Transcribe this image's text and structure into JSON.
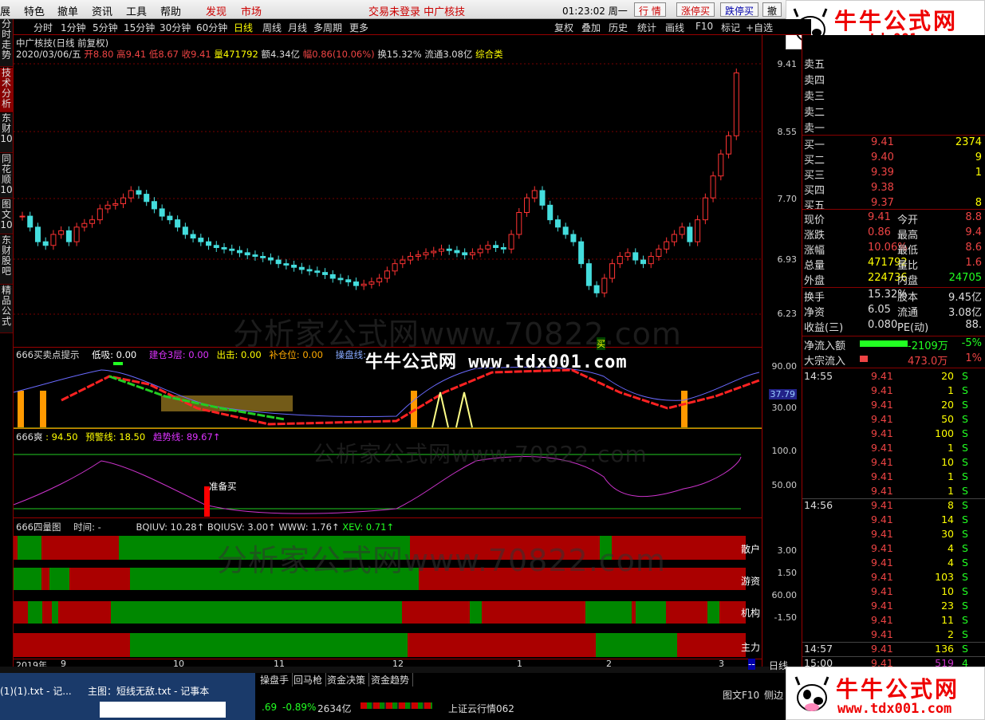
{
  "menu": {
    "items": [
      "展",
      "特色",
      "撤单",
      "资讯",
      "工具",
      "帮助"
    ],
    "red_items": [
      "发现",
      "市场"
    ],
    "status": "交易未登录 中广核技",
    "time": "01:23:02 周一",
    "right_buttons": [
      "行 情",
      "涨停买",
      "跌停买",
      "撤"
    ]
  },
  "sidebar": {
    "items": [
      "分时走势",
      "技术分析",
      "东财10",
      "同花顺10",
      "图文10",
      "东财股吧",
      "精品公式"
    ]
  },
  "periods": {
    "items": [
      "分时",
      "1分钟",
      "5分钟",
      "15分钟",
      "30分钟",
      "60分钟",
      "日线",
      "周线",
      "月线",
      "多周期",
      "更多"
    ],
    "right": [
      "复权",
      "叠加",
      "历史",
      "统计",
      "画线",
      "F10",
      "标记",
      "+自选"
    ]
  },
  "quote": {
    "title": "中广核技(日线 前复权)",
    "date": "2020/03/06/五",
    "open_label": "开",
    "open": "8.80",
    "high_label": "高",
    "high": "9.41",
    "low_label": "低",
    "low": "8.67",
    "close_label": "收",
    "close": "9.41",
    "vol_label": "量",
    "vol": "471792",
    "amt_label": "额",
    "amt": "4.34亿",
    "chg_label": "幅",
    "chg": "0.86(10.06%)",
    "turn": "换15.32%",
    "float": "流通3.08亿",
    "type": "综合类"
  },
  "yaxis": {
    "main": [
      "9.41",
      "8.55",
      "7.70",
      "6.93",
      "6.23"
    ],
    "ind1": [
      "90.00",
      "37.79",
      "30.00"
    ],
    "ind2": [
      "100.0",
      "50.00"
    ],
    "ind3": [
      "3.00",
      "1.50",
      "60.00",
      "-1.50"
    ]
  },
  "ind1": {
    "name": "666买卖点提示",
    "items": [
      {
        "t": "低吸: 0.00",
        "c": "#fff"
      },
      {
        "t": "建仓3层: 0.00",
        "c": "#d3f"
      },
      {
        "t": "出击: 0.00",
        "c": "#ff0"
      },
      {
        "t": "补仓位: 0.00",
        "c": "#fa0"
      },
      {
        "t": "操盘线:",
        "c": "#8af"
      }
    ],
    "marker": "买"
  },
  "ind2": {
    "name": "666爽",
    "v1": ": 94.50",
    "v2": "预警线: 18.50",
    "v3": "趋势线: 89.67↑",
    "signal": "准备买"
  },
  "ind3": {
    "name": "666四量图",
    "time": "时间: -",
    "v1": "BQIUV: 10.28↑",
    "v2": "BQIUSV: 3.00↑",
    "v3": "WWW: 1.76↑",
    "v4": "XEV: 0.71↑",
    "rows": [
      "散户",
      "游资",
      "机构",
      "主力"
    ]
  },
  "watermarks": [
    "分析家公式网www.70822.com",
    "牛牛公式网 www.tdx001.com",
    "公析家公式网www.70822.com"
  ],
  "logo": {
    "name": "牛牛公式网",
    "url": "www.tdx001.com"
  },
  "orderbook": {
    "sells": [
      "卖五",
      "卖四",
      "卖三",
      "卖二",
      "卖一"
    ],
    "buys": [
      {
        "l": "买一",
        "p": "9.41",
        "v": "2374"
      },
      {
        "l": "买二",
        "p": "9.40",
        "v": "9"
      },
      {
        "l": "买三",
        "p": "9.39",
        "v": "1"
      },
      {
        "l": "买四",
        "p": "9.38",
        "v": ""
      },
      {
        "l": "买五",
        "p": "9.37",
        "v": "8"
      }
    ]
  },
  "stats": [
    {
      "a": "现价",
      "av": "9.41",
      "b": "今开",
      "bv": "8.8"
    },
    {
      "a": "涨跌",
      "av": "0.86",
      "b": "最高",
      "bv": "9.4"
    },
    {
      "a": "涨幅",
      "av": "10.06%",
      "b": "最低",
      "bv": "8.6"
    },
    {
      "a": "总量",
      "av": "471792",
      "b": "量比",
      "bv": "1.6"
    },
    {
      "a": "外盘",
      "av": "224736",
      "b": "内盘",
      "bv": "24705"
    },
    {
      "a": "换手",
      "av": "15.32%",
      "b": "股本",
      "bv": "9.45亿"
    },
    {
      "a": "净资",
      "av": "6.05",
      "b": "流通",
      "bv": "3.08亿"
    },
    {
      "a": "收益(三)",
      "av": "0.080",
      "b": "PE(动)",
      "bv": "88."
    }
  ],
  "flow": [
    {
      "l": "净流入额",
      "v": "-2109万",
      "p": "-5%"
    },
    {
      "l": "大宗流入",
      "v": "473.0万",
      "p": "1%"
    }
  ],
  "ticks": [
    {
      "t": "14:55",
      "p": "9.41",
      "v": "20",
      "s": "S"
    },
    {
      "t": "",
      "p": "9.41",
      "v": "1",
      "s": "S"
    },
    {
      "t": "",
      "p": "9.41",
      "v": "20",
      "s": "S"
    },
    {
      "t": "",
      "p": "9.41",
      "v": "50",
      "s": "S"
    },
    {
      "t": "",
      "p": "9.41",
      "v": "100",
      "s": "S"
    },
    {
      "t": "",
      "p": "9.41",
      "v": "1",
      "s": "S"
    },
    {
      "t": "",
      "p": "9.41",
      "v": "10",
      "s": "S"
    },
    {
      "t": "",
      "p": "9.41",
      "v": "1",
      "s": "S"
    },
    {
      "t": "",
      "p": "9.41",
      "v": "1",
      "s": "S"
    },
    {
      "t": "14:56",
      "p": "9.41",
      "v": "8",
      "s": "S"
    },
    {
      "t": "",
      "p": "9.41",
      "v": "14",
      "s": "S"
    },
    {
      "t": "",
      "p": "9.41",
      "v": "30",
      "s": "S"
    },
    {
      "t": "",
      "p": "9.41",
      "v": "4",
      "s": "S"
    },
    {
      "t": "",
      "p": "9.41",
      "v": "4",
      "s": "S"
    },
    {
      "t": "",
      "p": "9.41",
      "v": "103",
      "s": "S"
    },
    {
      "t": "",
      "p": "9.41",
      "v": "10",
      "s": "S"
    },
    {
      "t": "",
      "p": "9.41",
      "v": "23",
      "s": "S"
    },
    {
      "t": "",
      "p": "9.41",
      "v": "11",
      "s": "S"
    },
    {
      "t": "",
      "p": "9.41",
      "v": "2",
      "s": "S"
    },
    {
      "t": "14:57",
      "p": "9.41",
      "v": "136",
      "s": "S"
    },
    {
      "t": "15:00",
      "p": "9.41",
      "v": "519",
      "s": "4"
    }
  ],
  "xaxis": [
    "2019年",
    "9",
    "10",
    "11",
    "12",
    "1",
    "2",
    "3"
  ],
  "bottom": {
    "tabs": [
      "操盘手",
      "回马枪",
      "资金决策",
      "资金趋势"
    ],
    "taskbar1": "(1)(1).txt - 记...",
    "taskbar2": "主图：短线无敌.txt - 记事本",
    "index": ".69",
    "index_chg": "-0.89%",
    "index_amt": "2634亿",
    "status": "上证云行情062",
    "f10": "图文F10",
    "side": "侧边",
    "dline": "日线",
    "mark": "--"
  },
  "chart_data": {
    "type": "candlestick",
    "title": "中广核技(日线 前复权)",
    "ylim": [
      6.0,
      9.6
    ],
    "close": [
      7.45,
      7.3,
      7.1,
      7.05,
      7.2,
      7.25,
      7.1,
      7.3,
      7.35,
      7.4,
      7.55,
      7.6,
      7.62,
      7.7,
      7.8,
      7.75,
      7.65,
      7.55,
      7.45,
      7.4,
      7.3,
      7.2,
      7.15,
      7.1,
      7.05,
      7.02,
      7.0,
      6.98,
      6.95,
      6.92,
      6.9,
      6.88,
      6.85,
      6.8,
      6.78,
      6.75,
      6.72,
      6.7,
      6.68,
      6.65,
      6.6,
      6.58,
      6.55,
      6.5,
      6.52,
      6.55,
      6.6,
      6.7,
      6.8,
      6.85,
      6.9,
      6.92,
      6.95,
      6.97,
      7.0,
      6.98,
      6.95,
      6.92,
      6.95,
      7.0,
      7.05,
      7.02,
      7.0,
      7.2,
      7.5,
      7.7,
      7.8,
      7.6,
      7.4,
      7.3,
      7.2,
      7.1,
      6.8,
      6.5,
      6.4,
      6.6,
      6.8,
      6.9,
      6.95,
      6.85,
      6.8,
      6.9,
      7.0,
      7.1,
      7.2,
      7.3,
      7.1,
      7.4,
      7.7,
      8.0,
      8.3,
      8.55,
      9.41
    ]
  }
}
